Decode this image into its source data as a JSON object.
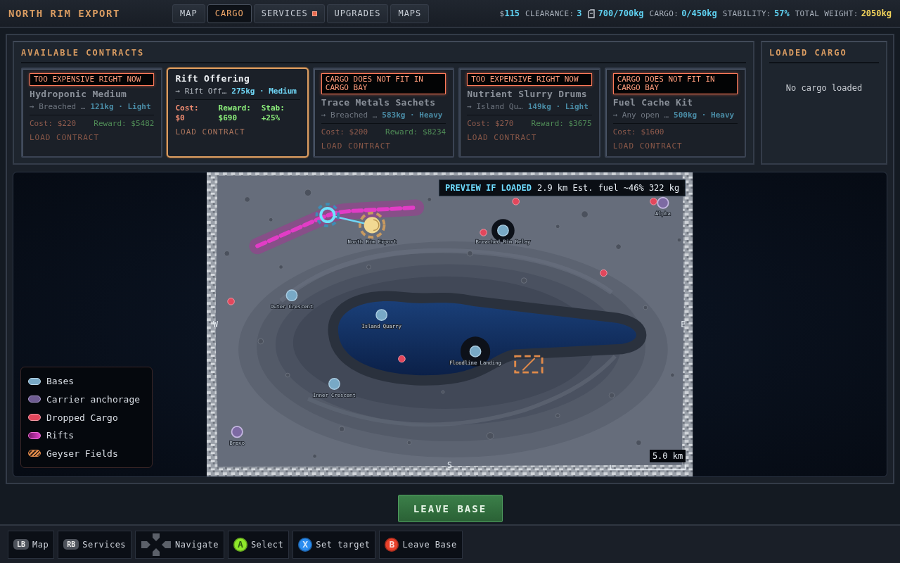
{
  "header": {
    "title": "NORTH RIM EXPORT"
  },
  "tabs": [
    {
      "label": "MAP",
      "selected": false,
      "alert": false
    },
    {
      "label": "CARGO",
      "selected": true,
      "alert": false
    },
    {
      "label": "SERVICES",
      "selected": false,
      "alert": true
    },
    {
      "label": "UPGRADES",
      "selected": false,
      "alert": false
    },
    {
      "label": "MAPS",
      "selected": false,
      "alert": false
    }
  ],
  "stats": [
    {
      "kind": "money",
      "label": "$",
      "value": "115"
    },
    {
      "kind": "plain",
      "label": "CLEARANCE:",
      "value": "3"
    },
    {
      "kind": "fuel",
      "value": "700/700kg"
    },
    {
      "kind": "plain",
      "label": "CARGO:",
      "value": "0/450kg"
    },
    {
      "kind": "plain",
      "label": "STABILITY:",
      "value": "57%"
    },
    {
      "kind": "total",
      "label": "TOTAL WEIGHT:",
      "value": "2050kg"
    }
  ],
  "contracts": {
    "title": "AVAILABLE CONTRACTS",
    "cards": [
      {
        "warning": "TOO EXPENSIVE RIGHT NOW",
        "title": "Hydroponic Medium",
        "destination": "→ Breached …",
        "load": "121kg · Light",
        "stats": [
          {
            "kind": "cost",
            "label": "Cost:",
            "value": "$220"
          },
          {
            "kind": "reward",
            "label": "Reward:",
            "value": "$5482"
          }
        ],
        "action": "LOAD CONTRACT",
        "selected": false,
        "available": false
      },
      {
        "title": "Rift Offering",
        "destination": "→ Rift Off…",
        "load": "275kg · Medium",
        "stats": [
          {
            "kind": "cost",
            "label": "Cost:",
            "value": "$0"
          },
          {
            "kind": "reward",
            "label": "Reward:",
            "value": "$690"
          },
          {
            "kind": "stability",
            "label": "Stab:",
            "value": "+25%"
          }
        ],
        "action": "LOAD CONTRACT",
        "selected": true,
        "available": true
      },
      {
        "warning": "CARGO DOES NOT FIT IN CARGO BAY",
        "title": "Trace Metals Sachets",
        "destination": "→ Breached …",
        "load": "583kg · Heavy",
        "stats": [
          {
            "kind": "cost",
            "label": "Cost:",
            "value": "$200"
          },
          {
            "kind": "reward",
            "label": "Reward:",
            "value": "$8234"
          }
        ],
        "action": "LOAD CONTRACT",
        "selected": false,
        "available": false
      },
      {
        "warning": "TOO EXPENSIVE RIGHT NOW",
        "title": "Nutrient Slurry Drums",
        "destination": "→ Island Qu…",
        "load": "149kg · Light",
        "stats": [
          {
            "kind": "cost",
            "label": "Cost:",
            "value": "$270"
          },
          {
            "kind": "reward",
            "label": "Reward:",
            "value": "$3675"
          }
        ],
        "action": "LOAD CONTRACT",
        "selected": false,
        "available": false
      },
      {
        "warning": "CARGO DOES NOT FIT IN CARGO BAY",
        "title": "Fuel Cache Kit",
        "destination": "→ Any open …",
        "load": "500kg · Heavy",
        "stats": [
          {
            "kind": "cost",
            "label": "Cost:",
            "value": "$1600"
          }
        ],
        "action": "LOAD CONTRACT",
        "selected": false,
        "available": false
      }
    ]
  },
  "loaded_cargo": {
    "title": "LOADED CARGO",
    "empty_text": "No cargo loaded"
  },
  "map": {
    "preview": {
      "title": "PREVIEW IF LOADED",
      "details": "2.9 km Est. fuel ~46% 322 kg"
    },
    "route_preview": true,
    "markers": [
      {
        "kind": "rift"
      },
      {
        "kind": "current",
        "label": "North Rim Export"
      },
      {
        "kind": "dropped"
      },
      {
        "kind": "dropped"
      },
      {
        "kind": "carrier",
        "label": "Alpha"
      },
      {
        "kind": "dropped"
      },
      {
        "kind": "base",
        "label": "Breached Rim Relay"
      },
      {
        "kind": "dropped"
      },
      {
        "kind": "base",
        "label": "Outer Crescent"
      },
      {
        "kind": "dropped"
      },
      {
        "kind": "base",
        "label": "Island Quarry"
      },
      {
        "kind": "dropped"
      },
      {
        "kind": "base",
        "label": "Floodline Landing"
      },
      {
        "kind": "geyser"
      },
      {
        "kind": "base",
        "label": "Inner Crescent"
      },
      {
        "kind": "carrier",
        "label": "Bravo"
      }
    ],
    "compass": {
      "west": "W",
      "east": "E",
      "south": "S"
    },
    "scale": "5.0 km"
  },
  "legend": [
    {
      "kind": "base",
      "label": "Bases"
    },
    {
      "kind": "carrier",
      "label": "Carrier anchorage"
    },
    {
      "kind": "dropped",
      "label": "Dropped Cargo"
    },
    {
      "kind": "rift",
      "label": "Rifts"
    },
    {
      "kind": "geyser",
      "label": "Geyser Fields"
    }
  ],
  "leave_button": "LEAVE BASE",
  "hints": [
    {
      "kind": "bumper",
      "key": "LB",
      "label": "Map"
    },
    {
      "kind": "bumper",
      "key": "RB",
      "label": "Services"
    },
    {
      "kind": "dpad",
      "label": "Navigate"
    },
    {
      "kind": "face",
      "key": "A",
      "color": "#8ee82a",
      "label": "Select"
    },
    {
      "kind": "face",
      "key": "X",
      "color": "#2a8cf0",
      "label": "Set target"
    },
    {
      "kind": "face",
      "key": "B",
      "color": "#e8402a",
      "label": "Leave Base"
    }
  ]
}
